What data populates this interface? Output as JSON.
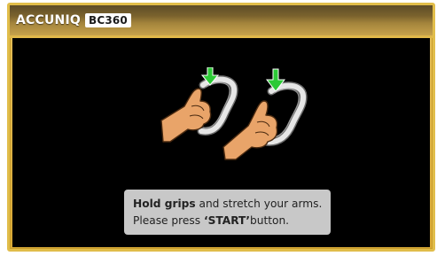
{
  "header": {
    "brand": "ACCUNIQ",
    "model": "BC360"
  },
  "message": {
    "line1_bold": "Hold grips",
    "line1_rest": " and stretch your arms.",
    "line2_prefix": "Please press ",
    "line2_bold": "‘START’",
    "line2_rest": "button."
  },
  "colors": {
    "frame": "#e1bd4a",
    "screen": "#000000",
    "message_box": "#c8c8c8",
    "arrow": "#2cc936",
    "skin": "#e9a469"
  }
}
